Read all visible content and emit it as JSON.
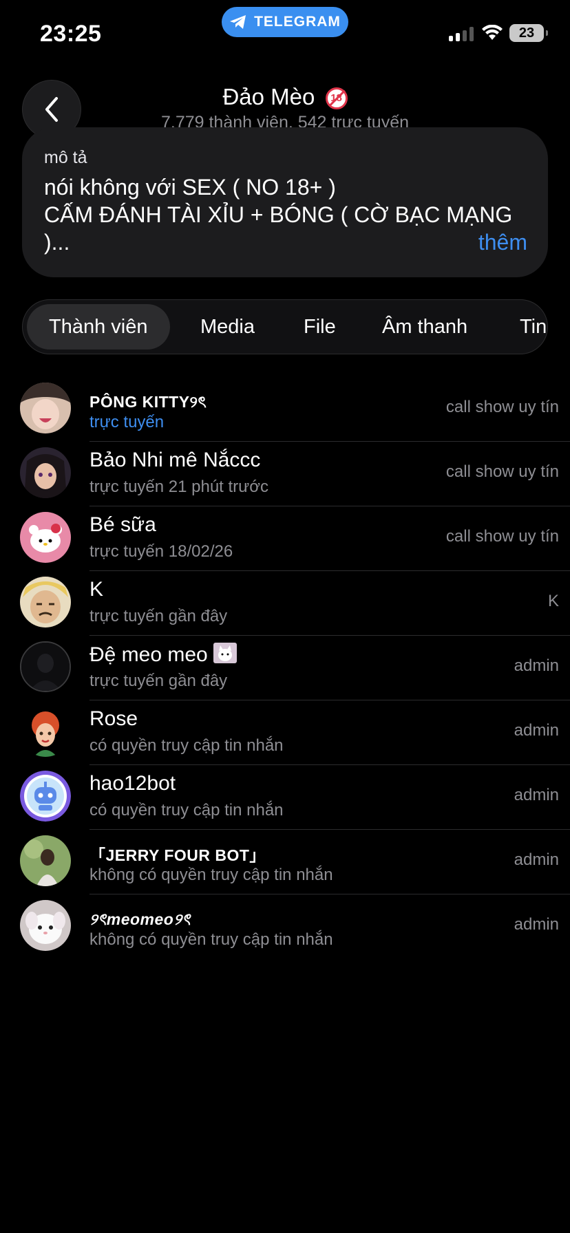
{
  "status_bar": {
    "time": "23:25",
    "app_pill": "TELEGRAM",
    "battery": "23"
  },
  "header": {
    "title": "Đảo Mèo",
    "subtitle": "7.779 thành viên, 542 trực tuyến",
    "back_icon": "chevron-left-icon"
  },
  "description": {
    "label": "mô tả",
    "line1": "nói không với SEX ( NO 18+ )",
    "line2": "CẤM ĐÁNH TÀI XỈU + BÓNG ( CỜ BẠC MẠNG",
    "line3": ")...",
    "more": "thêm"
  },
  "tabs": [
    {
      "label": "Thành viên",
      "active": true
    },
    {
      "label": "Media",
      "active": false
    },
    {
      "label": "File",
      "active": false
    },
    {
      "label": "Âm thanh",
      "active": false
    },
    {
      "label": "Tin",
      "active": false
    }
  ],
  "members": [
    {
      "name": "PÔNG KITTY୨ৎ",
      "status": "trực tuyến",
      "role": "call show uy tín"
    },
    {
      "name": "Bảo Nhi mê Nắccc",
      "status": "trực tuyến 21 phút trước",
      "role": "call show uy tín"
    },
    {
      "name": "Bé sữa",
      "status": "trực tuyến 18/02/26",
      "role": "call show uy tín"
    },
    {
      "name": "K",
      "status": "trực tuyến gần đây",
      "role": "K"
    },
    {
      "name": "Đệ meo meo",
      "status": "trực tuyến gần đây",
      "role": "admin"
    },
    {
      "name": "Rose",
      "status": "có quyền truy cập tin nhắn",
      "role": "admin"
    },
    {
      "name": "hao12bot",
      "status": "có quyền truy cập tin nhắn",
      "role": "admin"
    },
    {
      "name": "「JERRY FOUR BOT」",
      "status": "không có quyền truy cập tin nhắn",
      "role": "admin"
    },
    {
      "name": "୨ৎmeomeo୨ৎ",
      "status": "không có quyền truy cập tin nhắn",
      "role": "admin"
    }
  ],
  "colors": {
    "accent": "#3e8ef0",
    "background": "#000000",
    "card": "#1c1c1e",
    "secondary_text": "#8e8e93"
  }
}
